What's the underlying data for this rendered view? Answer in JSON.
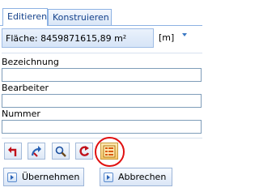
{
  "tabs": [
    {
      "label": "Editieren",
      "active": true
    },
    {
      "label": "Konstruieren",
      "active": false
    }
  ],
  "area": {
    "text": "Fläche: 8459871615,89 m²",
    "unit": "[m]"
  },
  "fields": [
    {
      "label": "Bezeichnung",
      "value": ""
    },
    {
      "label": "Bearbeiter",
      "value": ""
    },
    {
      "label": "Nummer",
      "value": ""
    }
  ],
  "toolbar": {
    "icons": [
      "undo-icon",
      "redo-icon",
      "zoom-icon",
      "reset-icon",
      "list-table-icon"
    ],
    "selected": "list-table-icon"
  },
  "actions": {
    "apply_label": "Übernehmen",
    "cancel_label": "Abbrechen"
  },
  "colors": {
    "tab_text": "#15428b",
    "highlight_ring": "#e01010",
    "accent_blue": "#3a78c3"
  }
}
